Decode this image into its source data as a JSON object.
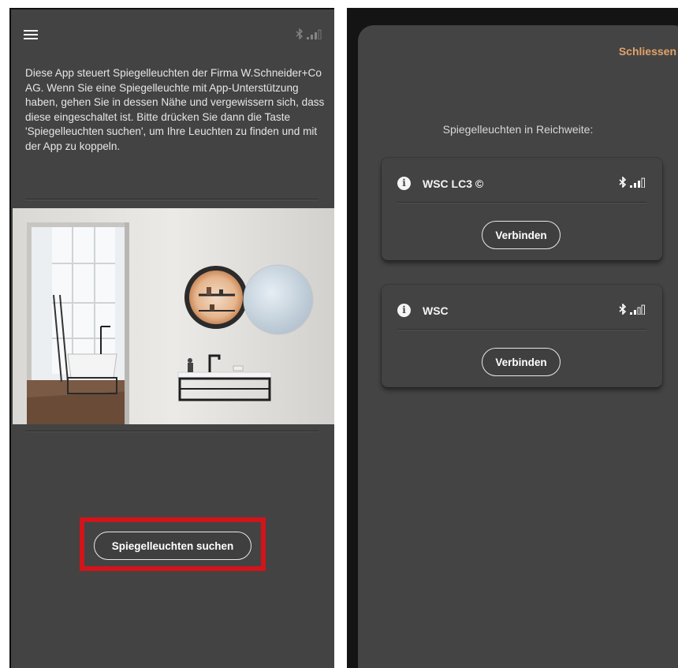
{
  "left_screen": {
    "intro_text": "Diese App steuert Spiegelleuchten der Firma W.Schneider+Co AG. Wenn Sie eine Spiegelleuchte mit App-Unterstützung haben, gehen Sie in dessen Nähe und vergewissern sich, dass diese eingeschaltet ist. Bitte drücken Sie dann die Taste 'Spiegelleuchten suchen', um Ihre Leuchten zu finden und mit der App zu koppeln.",
    "search_button_label": "Spiegelleuchten suchen",
    "menu_icon": "hamburger-menu-icon",
    "status_icons": [
      "bluetooth-icon",
      "signal-strength-icon"
    ]
  },
  "right_screen": {
    "close_label": "Schliessen",
    "range_title": "Spiegelleuchten in Reichweite:",
    "devices": [
      {
        "name": "WSC LC3 ©",
        "connect_label": "Verbinden",
        "signal_bars": 3
      },
      {
        "name": "WSC",
        "connect_label": "Verbinden",
        "signal_bars": 2
      }
    ]
  },
  "colors": {
    "screen_bg": "#434343",
    "accent_close": "#e3a36b",
    "highlight_frame": "#d2141b"
  }
}
